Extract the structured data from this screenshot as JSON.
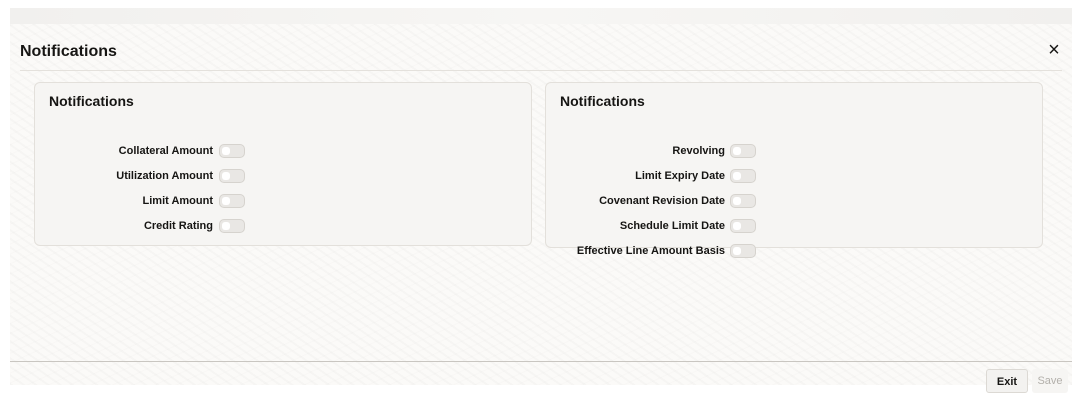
{
  "window": {
    "title": "Notifications",
    "close_glyph": "×"
  },
  "left_panel": {
    "title": "Notifications",
    "items": [
      {
        "label": "Collateral Amount",
        "checked": false
      },
      {
        "label": "Utilization Amount",
        "checked": false
      },
      {
        "label": "Limit Amount",
        "checked": false
      },
      {
        "label": "Credit Rating",
        "checked": false
      }
    ]
  },
  "right_panel": {
    "title": "Notifications",
    "items": [
      {
        "label": "Revolving",
        "checked": false
      },
      {
        "label": "Limit Expiry Date",
        "checked": false
      },
      {
        "label": "Covenant Revision Date",
        "checked": false
      },
      {
        "label": "Schedule Limit Date",
        "checked": false
      },
      {
        "label": "Effective Line Amount Basis",
        "checked": false
      }
    ]
  },
  "footer": {
    "exit_label": "Exit",
    "save_label": "Save"
  }
}
